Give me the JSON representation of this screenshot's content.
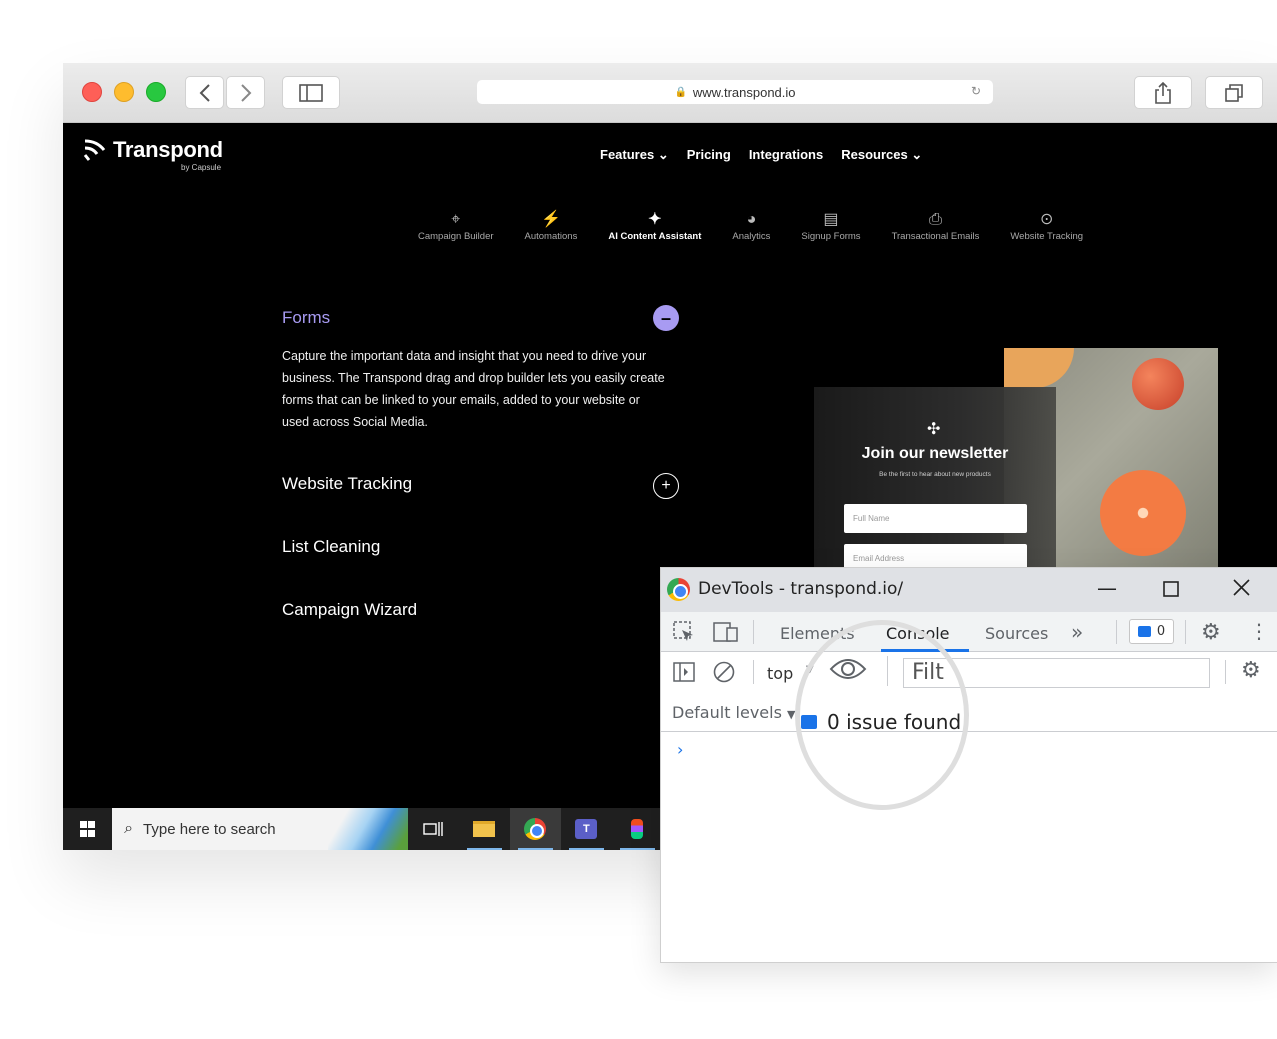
{
  "browser": {
    "url": "www.transpond.io",
    "icons": [
      "back-icon",
      "forward-icon",
      "sidebar-icon",
      "share-icon",
      "tabs-icon",
      "lock-icon",
      "reload-icon"
    ]
  },
  "site": {
    "logo": "Transpond",
    "logo_sub": "by Capsule",
    "nav": [
      {
        "label": "Features",
        "caret": "⌄"
      },
      {
        "label": "Pricing"
      },
      {
        "label": "Integrations"
      },
      {
        "label": "Resources",
        "caret": "⌄"
      }
    ],
    "subnav": [
      {
        "label": "Campaign Builder",
        "icon": "cursor-click-icon"
      },
      {
        "label": "Automations",
        "icon": "lightning-icon"
      },
      {
        "label": "AI Content Assistant",
        "icon": "sparkles-icon"
      },
      {
        "label": "Analytics",
        "icon": "pie-chart-icon"
      },
      {
        "label": "Signup Forms",
        "icon": "form-icon"
      },
      {
        "label": "Transactional Emails",
        "icon": "inbox-icon"
      },
      {
        "label": "Website Tracking",
        "icon": "target-icon"
      }
    ],
    "accordion": [
      {
        "title": "Forms",
        "expanded": true,
        "body": "Capture the important data and insight that you need to drive your business. The Transpond drag and drop builder lets you easily create forms that can be linked to your emails, added to your website or used across Social Media."
      },
      {
        "title": "Website Tracking"
      },
      {
        "title": "List Cleaning"
      },
      {
        "title": "Campaign Wizard"
      }
    ],
    "accent": "#a89bf2",
    "newsletter": {
      "title": "Join our newsletter",
      "subtitle": "Be the first to hear about new products",
      "name_placeholder": "Full Name",
      "email_placeholder": "Email Address"
    }
  },
  "taskbar": {
    "search_placeholder": "Type here to search",
    "icons": [
      "windows-start-icon",
      "task-view-icon",
      "file-explorer-icon",
      "chrome-icon",
      "teams-icon",
      "figma-icon"
    ]
  },
  "devtools": {
    "title": "DevTools - transpond.io/",
    "tabs": [
      "Elements",
      "Console",
      "Sources"
    ],
    "active_tab": "Console",
    "more_tabs": "»",
    "issues_count": "0",
    "context": "top",
    "filter_placeholder": "Filt",
    "levels": "Default levels",
    "issues_text": "0 issue found",
    "prompt": "›",
    "accent": "#1a73e8"
  }
}
